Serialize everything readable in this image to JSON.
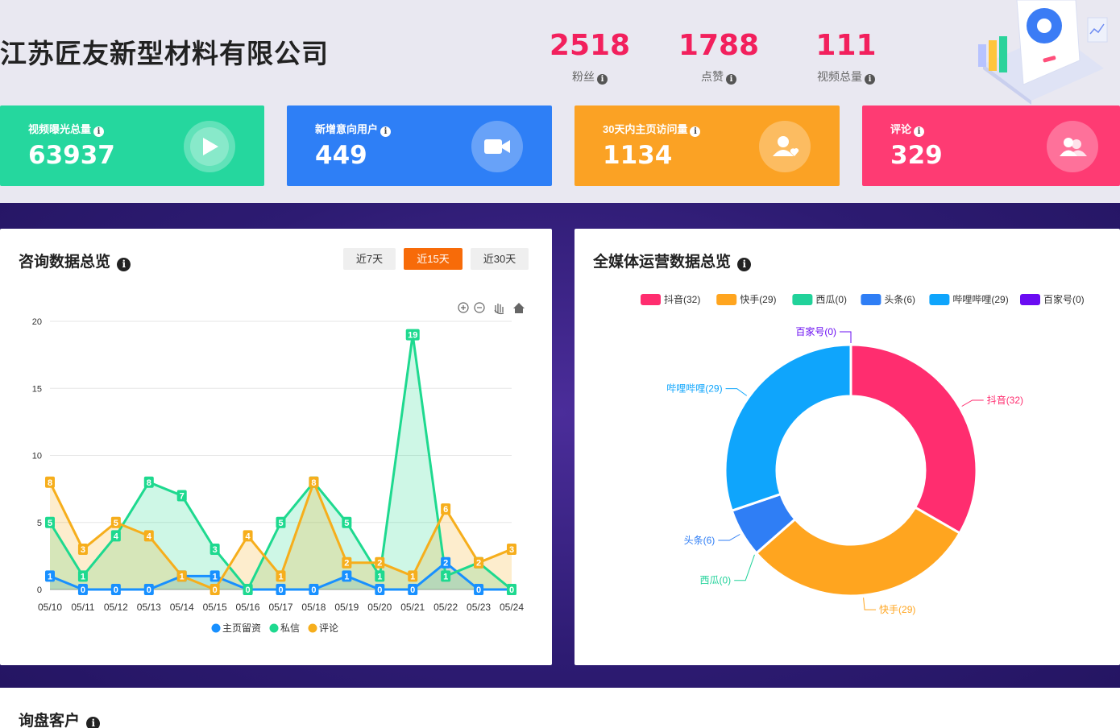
{
  "header": {
    "company": "江苏匠友新型材料有限公司",
    "stats": [
      {
        "value": "2518",
        "label": "粉丝"
      },
      {
        "value": "1788",
        "label": "点赞"
      },
      {
        "value": "111",
        "label": "视频总量"
      }
    ]
  },
  "cards": [
    {
      "title": "视频曝光总量",
      "value": "63937",
      "color": "#25d79e",
      "icon": "play-icon"
    },
    {
      "title": "新增意向用户",
      "value": "449",
      "color": "#2e7ff6",
      "icon": "video-camera-icon"
    },
    {
      "title": "30天内主页访问量",
      "value": "1134",
      "color": "#fba224",
      "icon": "user-heart-icon"
    },
    {
      "title": "评论",
      "value": "329",
      "color": "#fe3b73",
      "icon": "users-icon"
    }
  ],
  "consult": {
    "title": "咨询数据总览",
    "ranges": [
      "近7天",
      "近15天",
      "近30天"
    ],
    "active_range": "近15天"
  },
  "media": {
    "title": "全媒体运营数据总览"
  },
  "customers": {
    "title": "询盘客户"
  },
  "chart_data": [
    {
      "type": "line",
      "x": [
        "05/10",
        "05/11",
        "05/12",
        "05/13",
        "05/14",
        "05/15",
        "05/16",
        "05/17",
        "05/18",
        "05/19",
        "05/20",
        "05/21",
        "05/22",
        "05/23",
        "05/24"
      ],
      "ylim": [
        0,
        20
      ],
      "yticks": [
        0,
        5,
        10,
        15,
        20
      ],
      "grid": true,
      "legend": "bottom",
      "series": [
        {
          "name": "主页留资",
          "color": "#1890ff",
          "values": [
            1,
            0,
            0,
            0,
            1,
            1,
            0,
            0,
            0,
            1,
            0,
            0,
            2,
            0,
            0
          ]
        },
        {
          "name": "私信",
          "color": "#1ed98f",
          "values": [
            5,
            1,
            4,
            8,
            7,
            3,
            0,
            5,
            8,
            5,
            1,
            19,
            1,
            2,
            0
          ]
        },
        {
          "name": "评论",
          "color": "#f6ae1c",
          "values": [
            8,
            3,
            5,
            4,
            1,
            0,
            4,
            1,
            8,
            2,
            2,
            1,
            6,
            2,
            3
          ]
        }
      ]
    },
    {
      "type": "pie",
      "legend": "top",
      "categories": [
        "抖音",
        "快手",
        "西瓜",
        "头条",
        "哔哩哔哩",
        "百家号"
      ],
      "values": [
        32,
        29,
        0,
        6,
        29,
        0
      ],
      "colors": [
        "#ff2d6f",
        "#ffa51f",
        "#21d29a",
        "#2f7ef5",
        "#0fa5fc",
        "#6a0cf2"
      ],
      "labels": [
        "抖音(32)",
        "快手(29)",
        "西瓜(0)",
        "头条(6)",
        "哔哩哔哩(29)",
        "百家号(0)"
      ]
    }
  ]
}
